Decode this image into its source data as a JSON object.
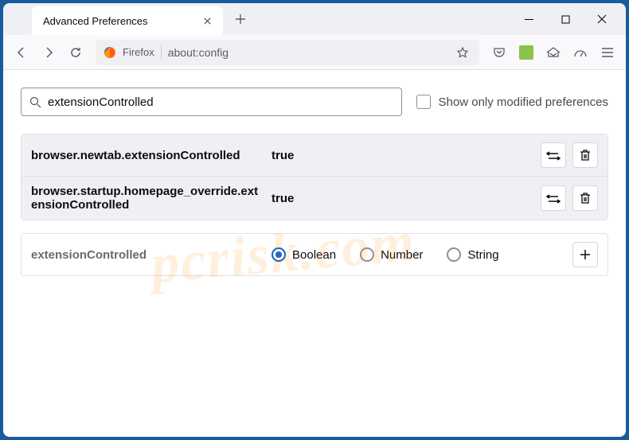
{
  "window": {
    "tab_title": "Advanced Preferences"
  },
  "url_bar": {
    "identity": "Firefox",
    "url": "about:config"
  },
  "content": {
    "search_value": "extensionControlled",
    "modified_only_label": "Show only modified preferences",
    "prefs": [
      {
        "name": "browser.newtab.extensionControlled",
        "value": "true"
      },
      {
        "name": "browser.startup.homepage_override.extensionControlled",
        "value": "true"
      }
    ],
    "new_pref": {
      "name": "extensionControlled",
      "types": {
        "boolean": "Boolean",
        "number": "Number",
        "string": "String"
      },
      "selected": "boolean"
    }
  },
  "watermark": "pcrisk.com"
}
